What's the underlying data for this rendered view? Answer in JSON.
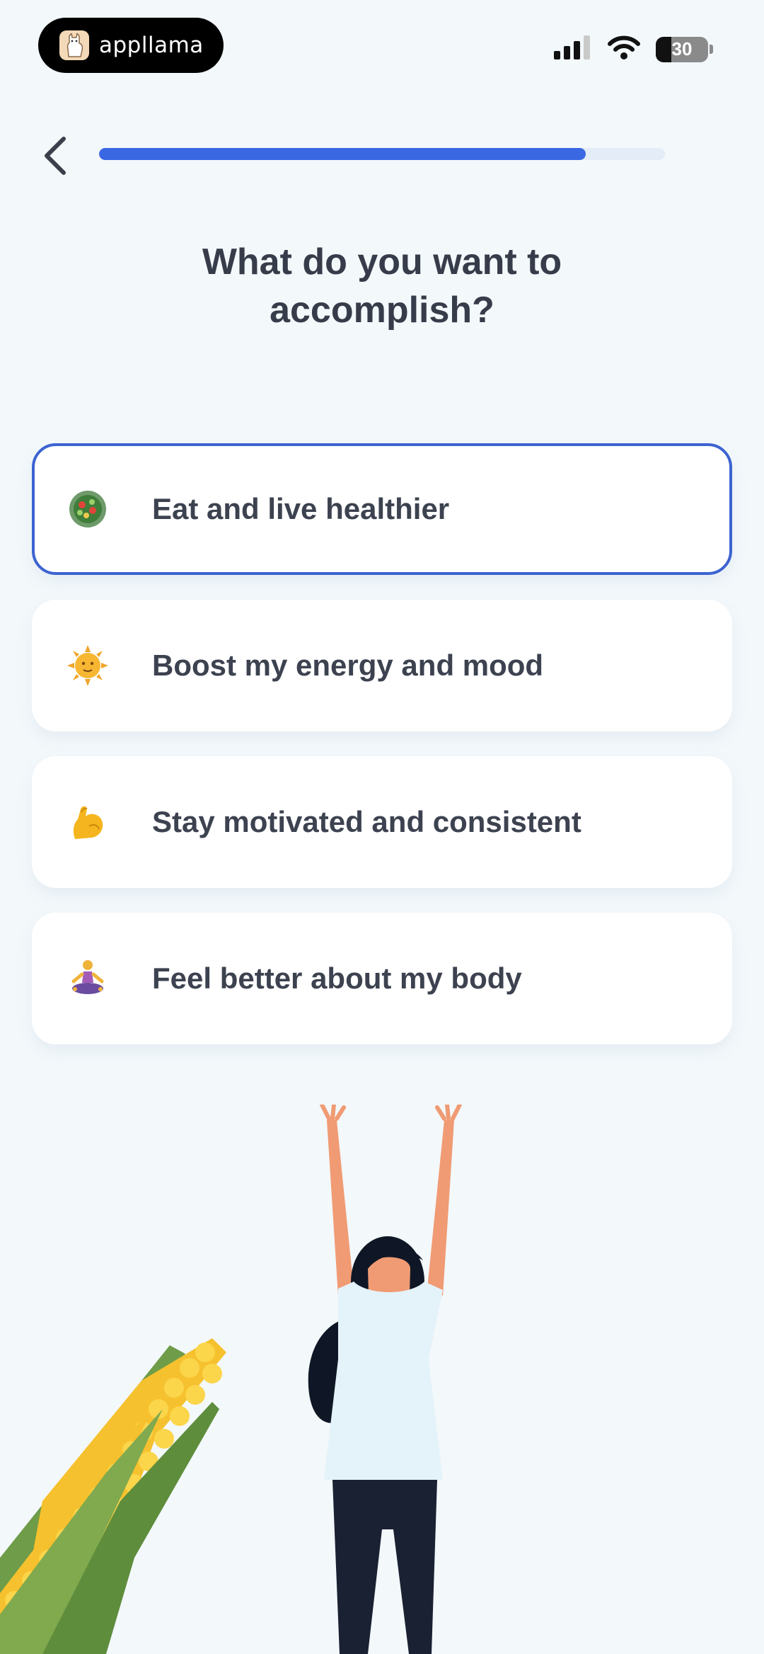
{
  "status_bar": {
    "brand_name": "appllama",
    "battery": 30
  },
  "header": {
    "progress_value": 0.86
  },
  "title": "What do you want to accomplish?",
  "options": [
    {
      "label": "Eat and live healthier",
      "icon": "salad-icon",
      "selected": true
    },
    {
      "label": "Boost my energy and mood",
      "icon": "sun-face-icon",
      "selected": false
    },
    {
      "label": "Stay motivated and consistent",
      "icon": "flexed-biceps-icon",
      "selected": false
    },
    {
      "label": "Feel better about my body",
      "icon": "meditation-icon",
      "selected": false
    }
  ],
  "colors": {
    "accent": "#3a67e2",
    "selected_border": "#3c63d0",
    "background": "#f3f8fb",
    "text": "#3d4250"
  }
}
